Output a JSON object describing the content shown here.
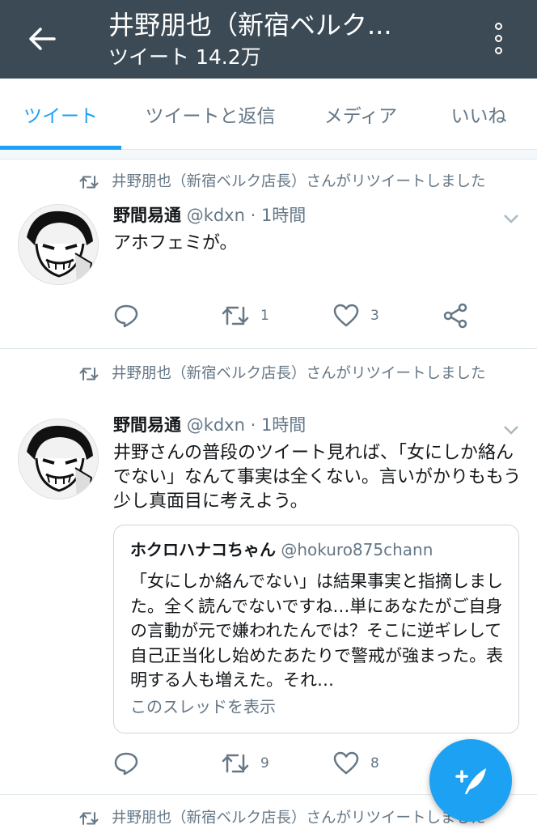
{
  "header": {
    "title": "井野朋也（新宿ベルク...",
    "subtitle": "ツイート 14.2万",
    "back_icon": "arrow-left-icon",
    "more_icon": "more-vertical-icon",
    "background": "#3b4a55"
  },
  "tabs": [
    {
      "label": "ツイート",
      "active": true
    },
    {
      "label": "ツイートと返信",
      "active": false
    },
    {
      "label": "メディア",
      "active": false
    },
    {
      "label": "いいね",
      "active": false
    }
  ],
  "accent_color": "#1da1f2",
  "tweets": [
    {
      "retweet_notice": "井野朋也（新宿ベルク店長）さんがリツイートしました",
      "author_name": "野間易通",
      "author_meta": "@kdxn · 1時間",
      "text": "アホフェミが。",
      "reply_count": "",
      "retweet_count": "1",
      "like_count": "3"
    },
    {
      "retweet_notice": "井野朋也（新宿ベルク店長）さんがリツイートしました",
      "author_name": "野間易通",
      "author_meta": "@kdxn · 1時間",
      "text": "井野さんの普段のツイート見れば、「女にしか絡んでない」なんて事実は全くない。言いがかりももう少し真面目に考えよう。",
      "quote": {
        "author_name": "ホクロハナコちゃん",
        "author_handle": "@hokuro875chann",
        "text": "「女にしか絡んでない」は結果事実と指摘しました。全く読んでないですね…単にあなたがご自身の言動が元で嫌われたんでは？そこに逆ギレして自己正当化し始めたあたりで警戒が強まった。表明する人も増えた。それ…",
        "thread_link": "このスレッドを表示"
      },
      "reply_count": "",
      "retweet_count": "9",
      "like_count": "8"
    },
    {
      "retweet_notice": "井野朋也（新宿ベルク店長）さんがリツイートしました"
    }
  ],
  "fab": {
    "icon": "compose-tweet-icon"
  }
}
